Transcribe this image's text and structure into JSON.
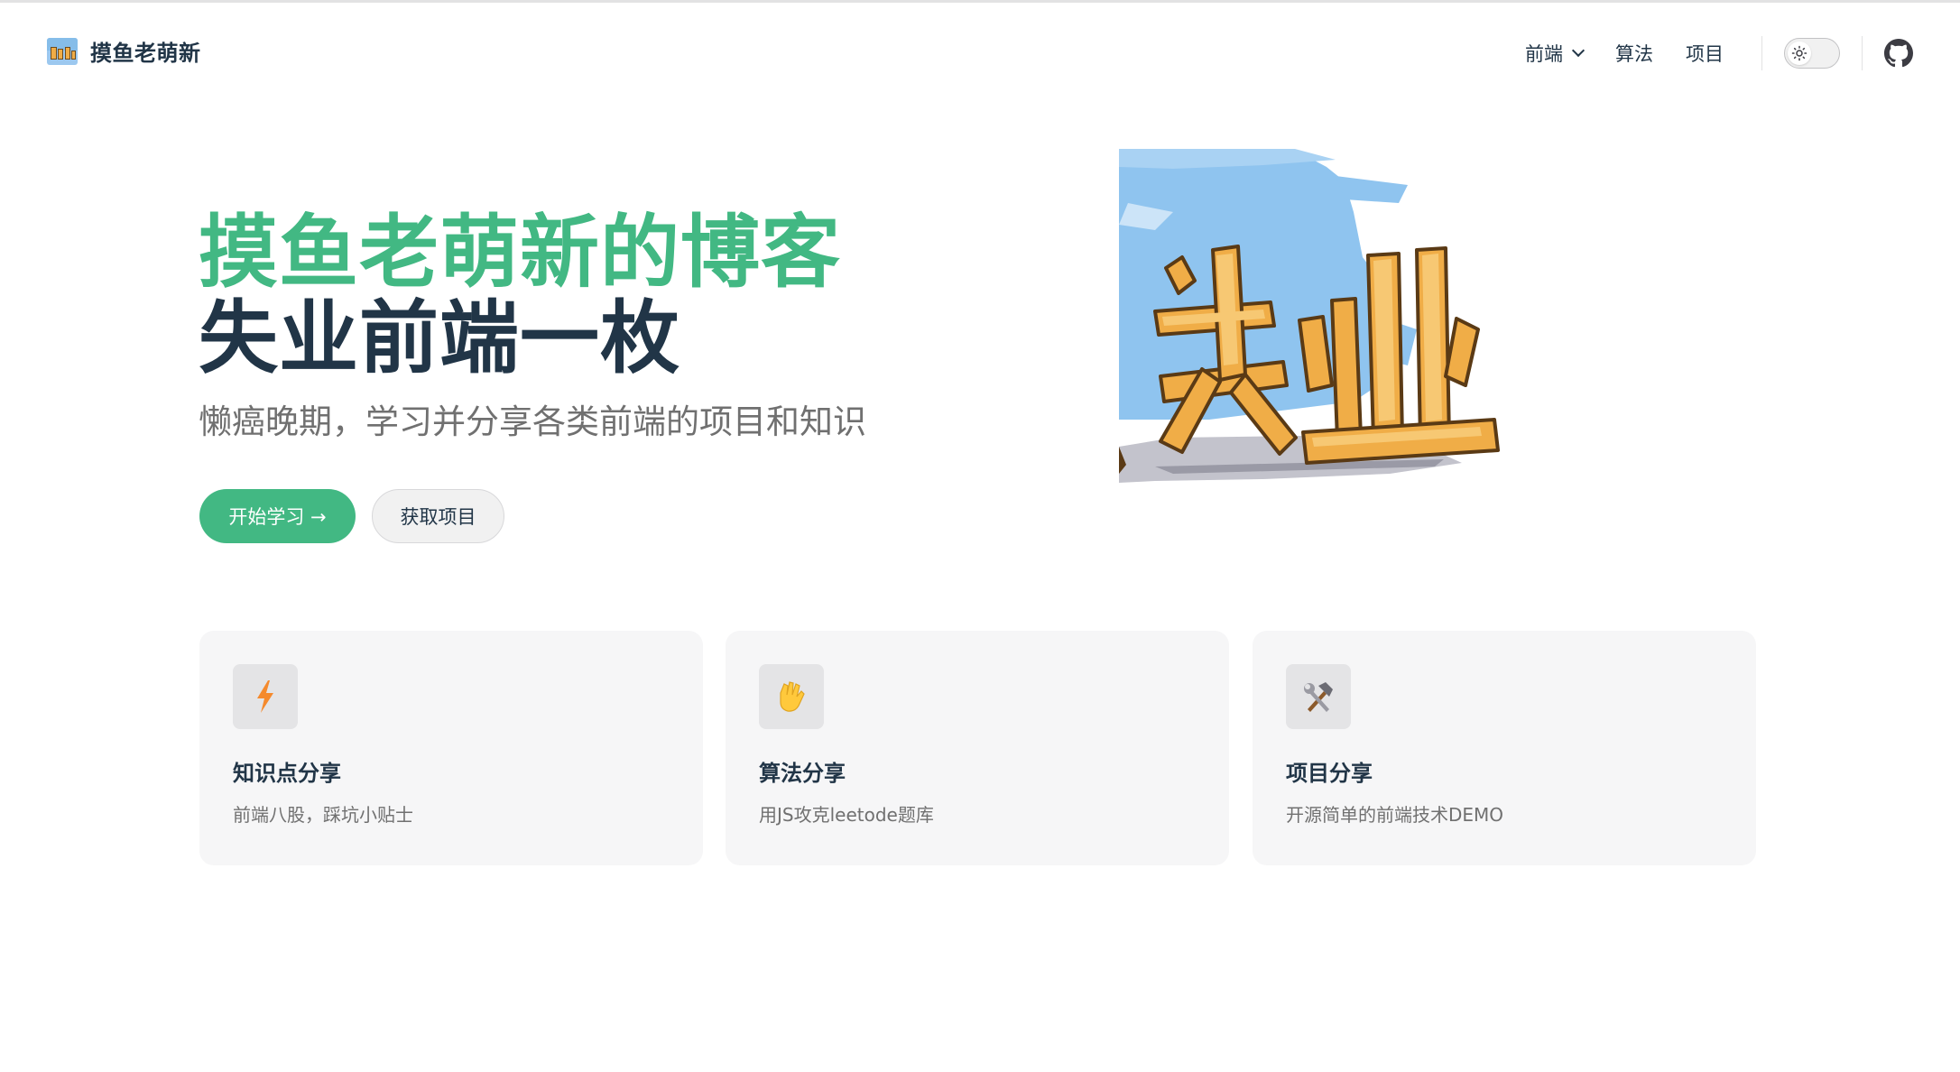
{
  "nav": {
    "brand_title": "摸鱼老萌新",
    "links": [
      {
        "label": "前端",
        "has_dropdown": true
      },
      {
        "label": "算法"
      },
      {
        "label": "项目"
      }
    ],
    "icons": [
      "sun-icon",
      "github-icon"
    ]
  },
  "hero": {
    "name": "摸鱼老萌新的博客",
    "text": "失业前端一枚",
    "tagline": "懒癌晚期，学习并分享各类前端的项目和知识",
    "image_text": "失业",
    "actions": [
      {
        "label": "开始学习 →",
        "theme": "brand"
      },
      {
        "label": "获取项目",
        "theme": "alt"
      }
    ]
  },
  "features": [
    {
      "icon": "lightning-icon",
      "title": "知识点分享",
      "details": "前端八股，踩坑小贴士"
    },
    {
      "icon": "vulcan-salute-icon",
      "title": "算法分享",
      "details": "用JS攻克leetode题库"
    },
    {
      "icon": "hammer-wrench-icon",
      "title": "项目分享",
      "details": "开源简单的前端技术DEMO"
    }
  ],
  "colors": {
    "brand": "#42b883",
    "text": "#213547",
    "muted": "#707070",
    "card_bg": "#f6f6f7"
  }
}
